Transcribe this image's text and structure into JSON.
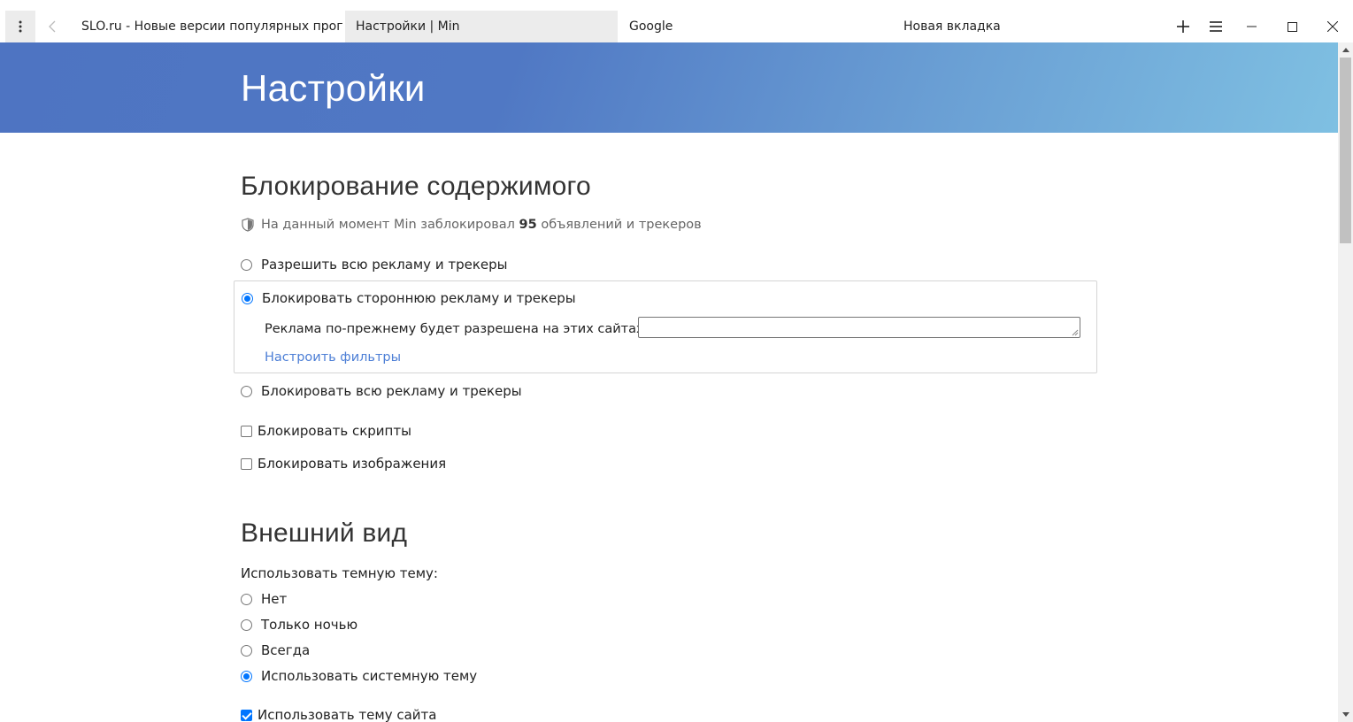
{
  "titlebar": {
    "tabs": [
      {
        "label": "SLO.ru - Новые версии популярных прог",
        "active": false
      },
      {
        "label": "Настройки | Min",
        "active": true
      },
      {
        "label": "Google",
        "active": false
      },
      {
        "label": "Новая вкладка",
        "active": false
      }
    ],
    "icons": {
      "menu": "vertical-dots-icon",
      "back": "chevron-left-icon",
      "add_tab": "plus-icon",
      "tasks": "hamburger-icon",
      "minimize": "minimize-icon",
      "maximize": "maximize-icon",
      "close": "close-icon"
    }
  },
  "header": {
    "title": "Настройки",
    "gradient_colors": [
      "#4e74c2",
      "#7fc0e2"
    ]
  },
  "content_blocking": {
    "title": "Блокирование содержимого",
    "info_prefix": "На данный момент Min заблокировал",
    "blocked_count": "95",
    "info_suffix": "объявлений и трекеров",
    "options": [
      {
        "label": "Разрешить всю рекламу и трекеры",
        "checked": false
      },
      {
        "label": "Блокировать стороннюю рекламу и трекеры",
        "checked": true
      },
      {
        "label": "Блокировать всю рекламу и трекеры",
        "checked": false
      }
    ],
    "whitelist_label": "Реклама по-прежнему будет разрешена на этих сайтах:",
    "whitelist_value": "",
    "filters_link": "Настроить фильтры",
    "block_scripts": {
      "label": "Блокировать скрипты",
      "checked": false
    },
    "block_images": {
      "label": "Блокировать изображения",
      "checked": false
    }
  },
  "appearance": {
    "title": "Внешний вид",
    "dark_theme_label": "Использовать темную тему:",
    "dark_theme_options": [
      {
        "label": "Нет",
        "checked": false
      },
      {
        "label": "Только ночью",
        "checked": false
      },
      {
        "label": "Всегда",
        "checked": false
      },
      {
        "label": "Использовать системную тему",
        "checked": true
      }
    ],
    "site_theme": {
      "label": "Использовать тему сайта",
      "checked": true
    }
  },
  "colors": {
    "accent": "#0075ff",
    "link": "#4d7fd6"
  }
}
